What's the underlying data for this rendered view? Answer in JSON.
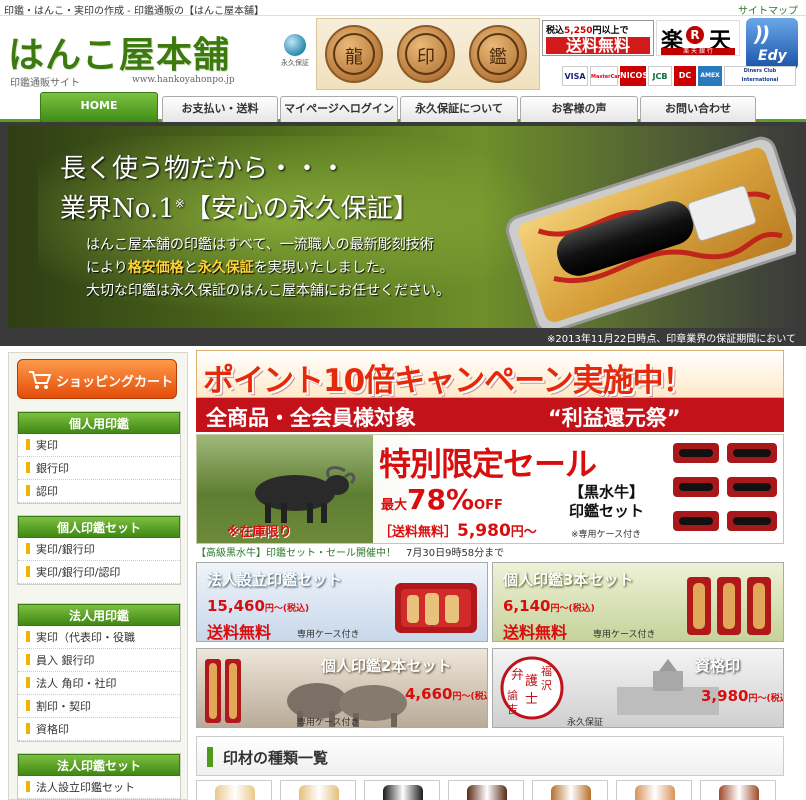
{
  "topbar": {
    "tagline": "印鑑・はんこ・実印の作成 - 印鑑通販の【はんこ屋本舗】",
    "sitemap": "サイトマップ"
  },
  "header": {
    "logo": "はんこ屋本舗",
    "logo_sub": "印鑑通販サイト",
    "logo_url": "www.hankoyahonpo.jp",
    "eternal_badge": "永久保証",
    "seal_glyphs": [
      "龍",
      "印",
      "鑑"
    ],
    "free_shipping": {
      "line1_prefix": "税込",
      "line1_amount": "5,250",
      "line1_suffix": "円以上で",
      "line2": "送料無料"
    },
    "rakuten": {
      "left": "楽",
      "mark": "R",
      "right": "天",
      "sub": "楽 天 銀 行"
    },
    "edy": "Edy",
    "cards": [
      "VISA",
      "MasterCard",
      "NICOS",
      "JCB",
      "DC",
      "AMEX",
      "Diners Club International"
    ]
  },
  "nav": {
    "tabs": [
      "HOME",
      "お支払い・送料",
      "マイページへログイン",
      "永久保証について",
      "お客様の声",
      "お問い合わせ"
    ]
  },
  "hero": {
    "line1": "長く使う物だから・・・",
    "line2_prefix": "業界No.1",
    "line2_mark": "※",
    "line2_suffix": "【安心の永久保証】",
    "p1": "はんこ屋本舗の印鑑はすべて、一流職人の最新彫刻技術",
    "p2_prefix": "により",
    "p2_hl1": "格安価格",
    "p2_mid": "と",
    "p2_hl2": "永久保証",
    "p2_suffix": "を実現いたしました。",
    "p3": "大切な印鑑は永久保証のはんこ屋本舗にお任せください。",
    "note": "※2013年11月22日時点、印章業界の保証期間において"
  },
  "sidebar": {
    "cart": "ショッピングカート",
    "groups": [
      {
        "title": "個人用印鑑",
        "items": [
          "実印",
          "銀行印",
          "認印"
        ]
      },
      {
        "title": "個人印鑑セット",
        "items": [
          "実印/銀行印",
          "実印/銀行印/認印"
        ]
      },
      {
        "title": "法人用印鑑",
        "items": [
          "実印（代表印・役職",
          "員入 銀行印",
          "法人 角印・社印",
          "割印・契印",
          "資格印"
        ]
      },
      {
        "title": "法人印鑑セット",
        "items": [
          "法人設立印鑑セット"
        ]
      }
    ]
  },
  "campaign": {
    "title": "ポイント10倍キャンペーン実施中！",
    "left": "全商品・全会員様対象",
    "right": "“利益還元祭”"
  },
  "sale": {
    "title": "特別限定セール",
    "max_prefix": "最大",
    "max_pct": "78%",
    "max_suffix": "OFF",
    "set_line1": "【黒水牛】",
    "set_line2": "印鑑セット",
    "stock": "※在庫限り",
    "price_prefix": "［送料無料］",
    "price": "5,980",
    "price_suffix": "円～",
    "case_note": "※専用ケース付き"
  },
  "notice": {
    "text": "【高級黒水牛】印鑑セット・セール開催中！",
    "time": "7月30日9時58分まで"
  },
  "tiles": [
    {
      "label": "法人設立印鑑セット",
      "price": "15,460",
      "tax": "円～(税込)",
      "free": "送料無料",
      "case": "専用ケース付き"
    },
    {
      "label": "個人印鑑3本セット",
      "price": "6,140",
      "tax": "円～(税込)",
      "free": "送料無料",
      "case": "専用ケース付き"
    },
    {
      "label": "個人印鑑2本セット",
      "price": "4,660",
      "tax": "円～(税込)",
      "case": "専用ケース付き"
    },
    {
      "label": "資格印",
      "price": "3,980",
      "tax": "円～(税込)",
      "case": "永久保証",
      "stamp_chars": [
        "弁",
        "護",
        "士",
        "福",
        "沢",
        "諭",
        "吉"
      ]
    }
  ],
  "materials": {
    "title": "印材の種類一覧",
    "swatches": [
      "#e9c98a",
      "#e4c07a",
      "#1a1a1a",
      "#5a2a14",
      "#b8702a",
      "#d7935a",
      "#a04a2a"
    ]
  },
  "colors": {
    "brand_green": "#3c7a10",
    "accent_red": "#d90d0d",
    "campaign_red": "#c4121a",
    "cart_orange": "#e24d0a",
    "highlight_yellow": "#ffd23a"
  }
}
